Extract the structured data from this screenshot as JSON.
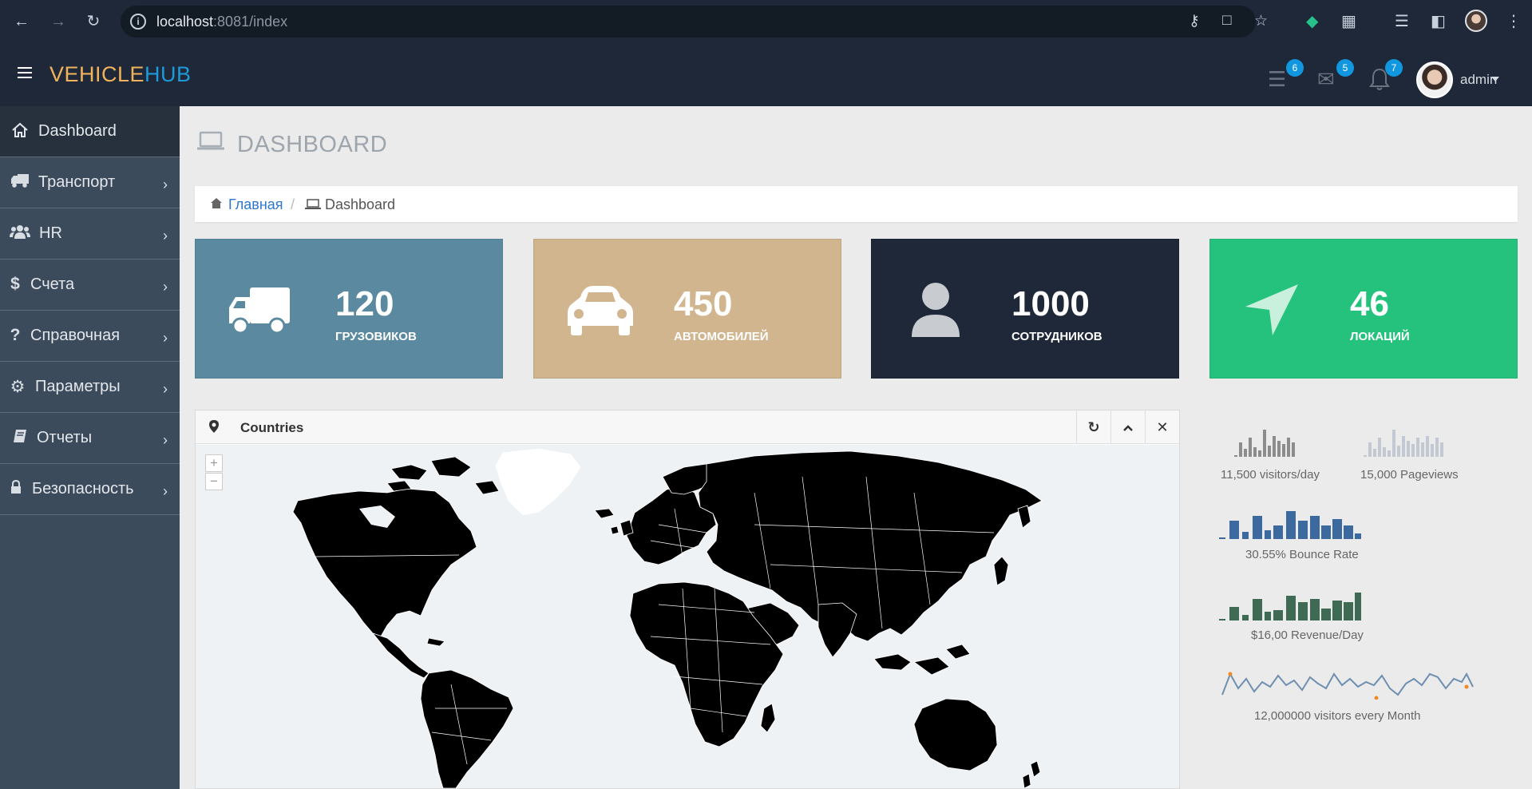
{
  "browser": {
    "url_host": "localhost",
    "url_rest": ":8081/index"
  },
  "app": {
    "logo_part1": "VEHICLE",
    "logo_part2": "HUB",
    "badges": {
      "tasks": "6",
      "messages": "5",
      "notifications": "7"
    },
    "user_name": "admin"
  },
  "sidebar": {
    "items": [
      {
        "label": "Dashboard",
        "icon": "home-icon"
      },
      {
        "label": "Транспорт",
        "icon": "truck-icon"
      },
      {
        "label": "HR",
        "icon": "users-icon"
      },
      {
        "label": "Счета",
        "icon": "dollar-icon"
      },
      {
        "label": "Справочная",
        "icon": "question-icon"
      },
      {
        "label": "Параметры",
        "icon": "gear-icon"
      },
      {
        "label": "Отчеты",
        "icon": "book-icon"
      },
      {
        "label": "Безопасность",
        "icon": "lock-icon"
      }
    ]
  },
  "page": {
    "title": "DASHBOARD",
    "breadcrumb_home": "Главная",
    "breadcrumb_current": "Dashboard"
  },
  "stats": [
    {
      "value": "120",
      "label": "ГРУЗОВИКОВ",
      "color": "#5b8aa0",
      "icon": "truck-icon"
    },
    {
      "value": "450",
      "label": "АВТОМОБИЛЕЙ",
      "color": "#d0b58f",
      "icon": "car-icon"
    },
    {
      "value": "1000",
      "label": "СОТРУДНИКОВ",
      "color": "#1e2838",
      "icon": "user-icon"
    },
    {
      "value": "46",
      "label": "ЛОКАЦИЙ",
      "color": "#25c27e",
      "icon": "location-arrow-icon"
    }
  ],
  "widget": {
    "title": "Countries"
  },
  "sparklines": {
    "visitors_label": "11,500 visitors/day",
    "pageviews_label": "15,000 Pageviews",
    "bounce_label": "30.55% Bounce Rate",
    "revenue_label": "$16,00 Revenue/Day",
    "monthly_label": "12,000000 visitors every Month",
    "colors": {
      "visitors": "#8c8c8c",
      "pageviews": "#c3c9d2",
      "bounce": "#3d6a9e",
      "revenue": "#3f6b54",
      "monthly": "#6f8fb0"
    }
  }
}
